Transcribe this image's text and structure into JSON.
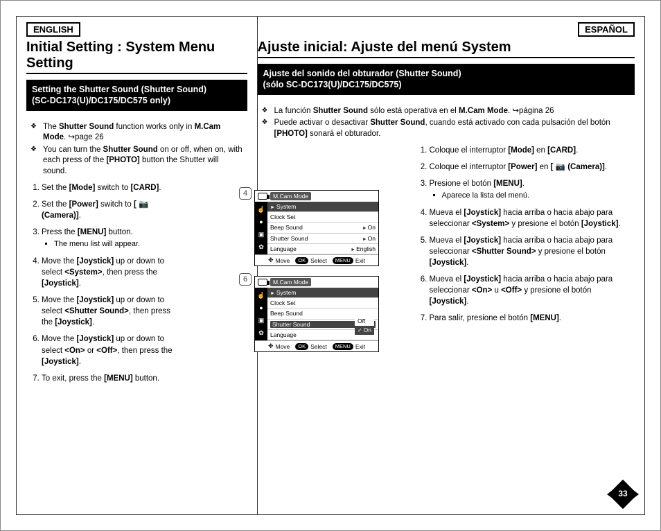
{
  "page_number": "33",
  "left": {
    "lang_label": "ENGLISH",
    "title": "Initial Setting : System Menu Setting",
    "section_title_l1": "Setting the Shutter Sound (Shutter Sound)",
    "section_title_l2": "(SC-DC173(U)/DC175/DC575 only)",
    "notes": [
      "The <b>Shutter Sound</b> function works only in <b>M.Cam Mode</b>. ↪page 26",
      "You can turn the <b>Shutter Sound</b> on or off, when on, with each press of the <b>[PHOTO]</b> button the Shutter will sound."
    ],
    "steps": [
      "Set the <b>[Mode]</b> switch to <b>[CARD]</b>.",
      "Set the <b>[Power]</b> switch to <b>[ 📷 (Camera)]</b>.",
      "Press the <b>[MENU]</b> button.",
      "Move the <b>[Joystick]</b> up or down to select <b>&lt;System&gt;</b>, then press the <b>[Joystick]</b>.",
      "Move the <b>[Joystick]</b> up or down to select <b>&lt;Shutter Sound&gt;</b>, then press the <b>[Joystick]</b>.",
      "Move the <b>[Joystick]</b> up or down to select <b>&lt;On&gt;</b> or <b>&lt;Off&gt;</b>, then press the <b>[Joystick]</b>.",
      "To exit, press the <b>[MENU]</b> button."
    ],
    "step3_sub": "The menu list will appear."
  },
  "right": {
    "lang_label": "ESPAÑOL",
    "title": "Ajuste inicial: Ajuste del menú System",
    "section_title_l1": "Ajuste del sonido del obturador (Shutter Sound)",
    "section_title_l2": "(sólo SC-DC173(U)/DC175/DC575)",
    "notes": [
      "La función <b>Shutter Sound</b> sólo está operativa en el <b>M.Cam Mode</b>. ↪página 26",
      "Puede activar o desactivar <b>Shutter Sound</b>, cuando está activado con cada pulsación del botón <b>[PHOTO]</b> sonará el obturador."
    ],
    "steps": [
      "Coloque el interruptor <b>[Mode]</b> en <b>[CARD]</b>.",
      "Coloque el interruptor <b>[Power]</b> en <b>[ 📷 (Camera)]</b>.",
      "Presione el botón <b>[MENU]</b>.",
      "Mueva el <b>[Joystick]</b> hacia arriba o hacia abajo para seleccionar <b>&lt;System&gt;</b> y presione el botón <b>[Joystick]</b>.",
      "Mueva el <b>[Joystick]</b> hacia arriba o hacia abajo para seleccionar <b>&lt;Shutter Sound&gt;</b> y presione el botón <b>[Joystick]</b>.",
      "Mueva el <b>[Joystick]</b> hacia arriba o hacia abajo para seleccionar <b>&lt;On&gt;</b> u <b>&lt;Off&gt;</b> y presione el botón <b>[Joystick]</b>.",
      "Para salir, presione el botón <b>[MENU]</b>."
    ],
    "step3_sub": "Aparece la lista del menú."
  },
  "screens": {
    "num1": "4",
    "num2": "6",
    "mode": "M.Cam Mode",
    "header": "System",
    "rows1": [
      {
        "label": "Clock Set",
        "value": ""
      },
      {
        "label": "Beep Sound",
        "value": "On",
        "arrow": true
      },
      {
        "label": "Shutter Sound",
        "value": "On",
        "arrow": true
      },
      {
        "label": "Language",
        "value": "English",
        "arrow": true
      }
    ],
    "rows2": [
      {
        "label": "Clock Set",
        "value": ""
      },
      {
        "label": "Beep Sound",
        "value": ""
      },
      {
        "label": "Shutter Sound",
        "value": "",
        "selected": true
      },
      {
        "label": "Language",
        "value": ""
      }
    ],
    "popup": {
      "off": "Off",
      "on": "On"
    },
    "footer": {
      "move": "Move",
      "select": "Select",
      "exit": "Exit",
      "ok": "OK",
      "menu": "MENU"
    }
  }
}
